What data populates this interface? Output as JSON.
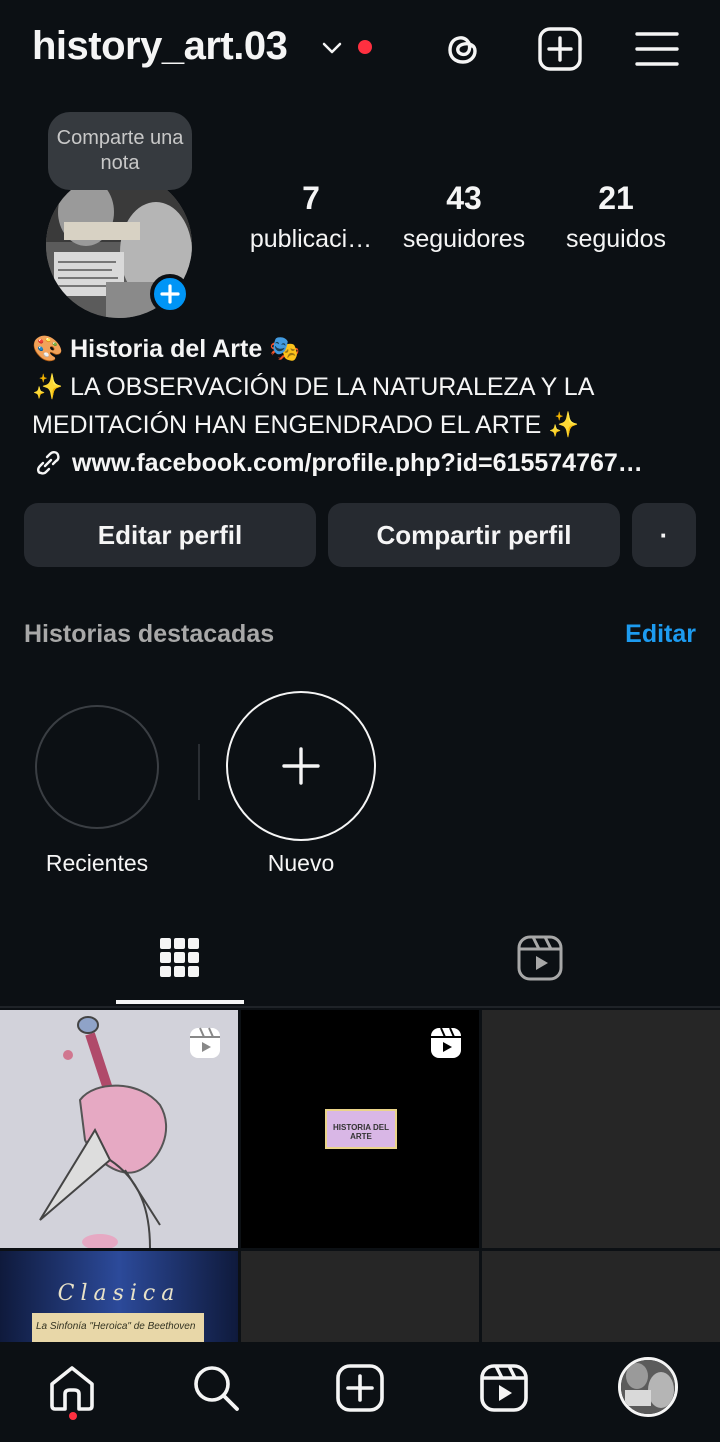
{
  "header": {
    "username": "history_art.03",
    "icons": [
      "chevron-down-icon",
      "threads-icon",
      "create-post-icon",
      "menu-icon"
    ]
  },
  "profile": {
    "note_bubble": "Comparte una nota",
    "stats": [
      {
        "value": "7",
        "label": "publicaci…"
      },
      {
        "value": "43",
        "label": "seguidores"
      },
      {
        "value": "21",
        "label": "seguidos"
      }
    ],
    "bio": {
      "name_emoji_left": "🎨",
      "name": "Historia del Arte",
      "name_emoji_right": "🎭",
      "line1": "✨ LA OBSERVACIÓN DE LA NATURALEZA Y LA",
      "line2": "MEDITACIÓN HAN ENGENDRADO EL ARTE ✨",
      "link": "www.facebook.com/profile.php?id=615574767…"
    }
  },
  "actions": {
    "edit_profile": "Editar perfil",
    "share_profile": "Compartir perfil",
    "more": "·"
  },
  "highlights": {
    "title": "Historias destacadas",
    "edit": "Editar",
    "items": [
      {
        "label": "Recientes"
      },
      {
        "label": "Nuevo"
      }
    ]
  },
  "grid": {
    "post1_title": "",
    "post4_text": "Clasica",
    "post4_sub": "La Sinfonía \"Heroica\" de Beethoven",
    "post2_caption": "HISTORIA DEL ARTE"
  },
  "colors": {
    "background": "#0c1014",
    "accent": "#0095f6",
    "link_blue": "#1d9bf0",
    "notification_red": "#ff3040"
  }
}
